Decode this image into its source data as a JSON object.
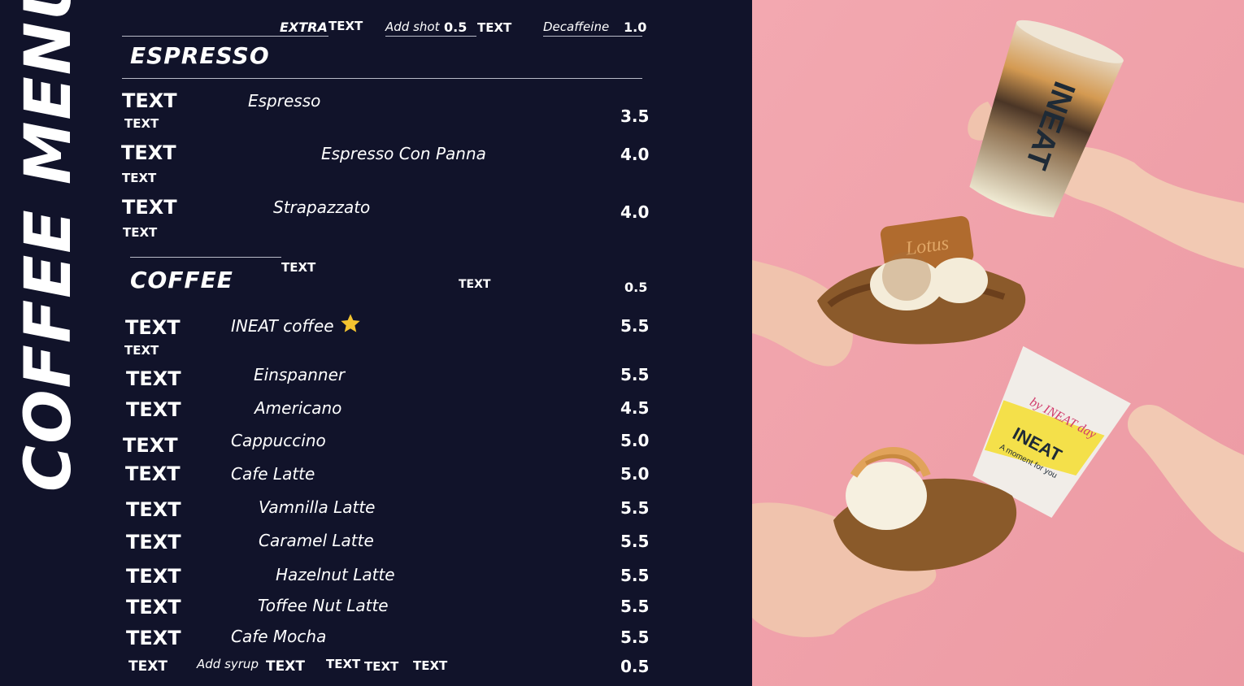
{
  "title": "COFFEE MENU",
  "extras": {
    "extra_label": "EXTRA",
    "extra_text": "TEXT",
    "add_shot_label": "Add shot",
    "add_shot_price": "0.5",
    "add_shot_text": "TEXT",
    "decaf_label": "Decaffeine",
    "decaf_price": "1.0"
  },
  "espresso": {
    "title": "ESPRESSO",
    "items": [
      {
        "code": "TEXT",
        "sub": "TEXT",
        "name": "Espresso",
        "price": "3.5"
      },
      {
        "code": "TEXT",
        "sub": "TEXT",
        "name": "Espresso Con Panna",
        "price": "4.0"
      },
      {
        "code": "TEXT",
        "sub": "TEXT",
        "name": "Strapazzato",
        "price": "4.0"
      }
    ]
  },
  "coffee": {
    "title": "COFFEE",
    "header_text_1": "TEXT",
    "header_text_2": "TEXT",
    "header_price": "0.5",
    "items": [
      {
        "code": "TEXT",
        "sub": "TEXT",
        "name": "INEAT coffee",
        "price": "5.5",
        "star": true
      },
      {
        "code": "TEXT",
        "name": "Einspanner",
        "price": "5.5"
      },
      {
        "code": "TEXT",
        "name": "Americano",
        "price": "4.5"
      },
      {
        "code": "TEXT",
        "name": "Cappuccino",
        "price": "5.0"
      },
      {
        "code": "TEXT",
        "name": "Cafe Latte",
        "price": "5.0"
      },
      {
        "code": "TEXT",
        "name": "Vamnilla Latte",
        "price": "5.5"
      },
      {
        "code": "TEXT",
        "name": "Caramel Latte",
        "price": "5.5"
      },
      {
        "code": "TEXT",
        "name": "Hazelnut Latte",
        "price": "5.5"
      },
      {
        "code": "TEXT",
        "name": "Toffee Nut Latte",
        "price": "5.5"
      },
      {
        "code": "TEXT",
        "name": "Cafe Mocha",
        "price": "5.5"
      }
    ]
  },
  "footer": {
    "code": "TEXT",
    "add_syrup_label": "Add syrup",
    "syrup_1": "TEXT",
    "syrup_2": "TEXT",
    "syrup_3": "TEXT",
    "syrup_4": "TEXT",
    "price": "0.5"
  },
  "photo": {
    "background": "#f0a2aa",
    "cup_brand": "INEAT",
    "cup_tagline": "by INEAT day",
    "cup_sub": "A moment for you",
    "cookie_text": "Lotus"
  },
  "colors": {
    "panel": "#11132a",
    "text": "#ffffff",
    "star": "#f4c430",
    "rule": "#b9bbc8"
  }
}
